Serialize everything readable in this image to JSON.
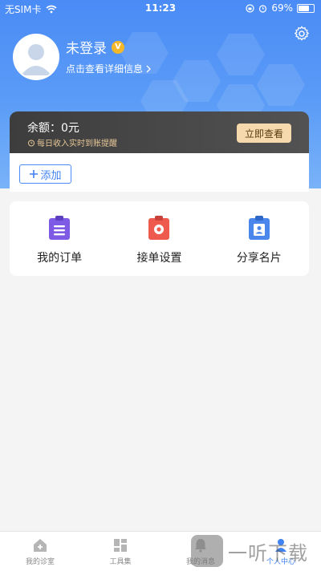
{
  "status_bar": {
    "carrier": "无SIM卡",
    "time": "11:23",
    "battery": "69%",
    "battery_level": 0.69
  },
  "profile": {
    "nickname": "未登录",
    "vip_badge": "V",
    "subtitle": "点击查看详细信息"
  },
  "balance": {
    "label": "余额：0元",
    "note": "每日收入实时到账提醒",
    "button": "立即查看"
  },
  "add_button": {
    "label": "添加"
  },
  "menu": [
    {
      "label": "我的订单",
      "icon": "order-list-icon"
    },
    {
      "label": "接单设置",
      "icon": "order-settings-icon"
    },
    {
      "label": "分享名片",
      "icon": "business-card-icon"
    }
  ],
  "tabs": [
    {
      "label": "我的诊室",
      "icon": "clinic-home-icon",
      "active": false
    },
    {
      "label": "工具集",
      "icon": "toolkit-grid-icon",
      "active": false
    },
    {
      "label": "我的消息",
      "icon": "bell-icon",
      "active": false
    },
    {
      "label": "个人中心",
      "icon": "person-icon",
      "active": true
    }
  ],
  "watermark": {
    "text": "一听下载"
  },
  "colors": {
    "primary": "#3f82f2",
    "header_gradient_start": "#4a8bf6",
    "balance_bg": "#3d3d3d",
    "check_button": "#f6d9ac",
    "vip_gold": "#f5b82a"
  }
}
